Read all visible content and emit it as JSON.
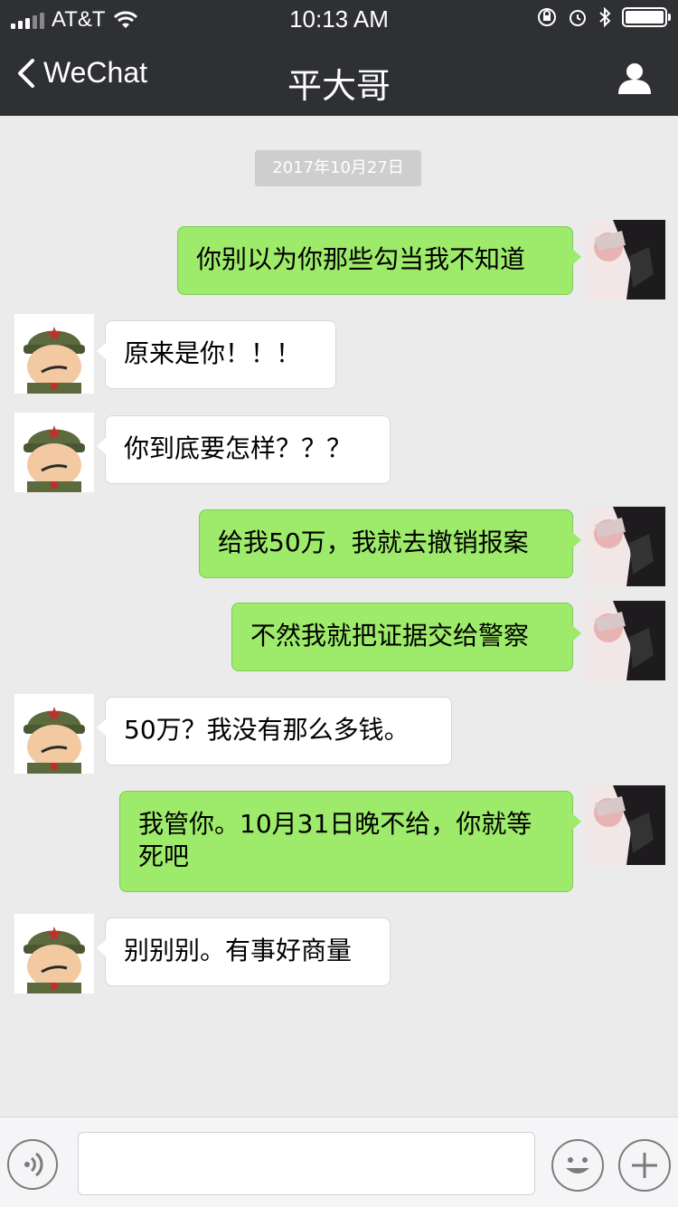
{
  "status_bar": {
    "carrier": "AT&T",
    "time": "10:13 AM",
    "wifi_icon": "wifi-icon",
    "orientation_lock_icon": "orientation-lock-icon",
    "alarm_icon": "alarm-icon",
    "bluetooth_icon": "bluetooth-icon",
    "battery_icon": "battery-icon"
  },
  "nav": {
    "back_label": "WeChat",
    "title": "平大哥",
    "profile_icon": "person-icon"
  },
  "chat": {
    "date": "2017年10月27日",
    "messages": [
      {
        "dir": "out",
        "text": "你别以为你那些勾当我不知道"
      },
      {
        "dir": "in",
        "text": "原来是你！！！"
      },
      {
        "dir": "in",
        "text": "你到底要怎样？？？"
      },
      {
        "dir": "out",
        "text": "给我50万，我就去撤销报案"
      },
      {
        "dir": "out",
        "text": "不然我就把证据交给警察"
      },
      {
        "dir": "in",
        "text": "50万？我没有那么多钱。"
      },
      {
        "dir": "out",
        "text": "我管你。10月31日晚不给，你就等死吧"
      },
      {
        "dir": "in",
        "text": "别别别。有事好商量"
      }
    ]
  },
  "input_bar": {
    "voice_icon": "voice-icon",
    "text_value": "",
    "emoji_icon": "emoji-icon",
    "plus_icon": "plus-icon"
  },
  "colors": {
    "header_bg": "#2f3033",
    "chat_bg": "#ebebeb",
    "outgoing_bubble": "#9eea6a",
    "incoming_bubble": "#ffffff"
  }
}
